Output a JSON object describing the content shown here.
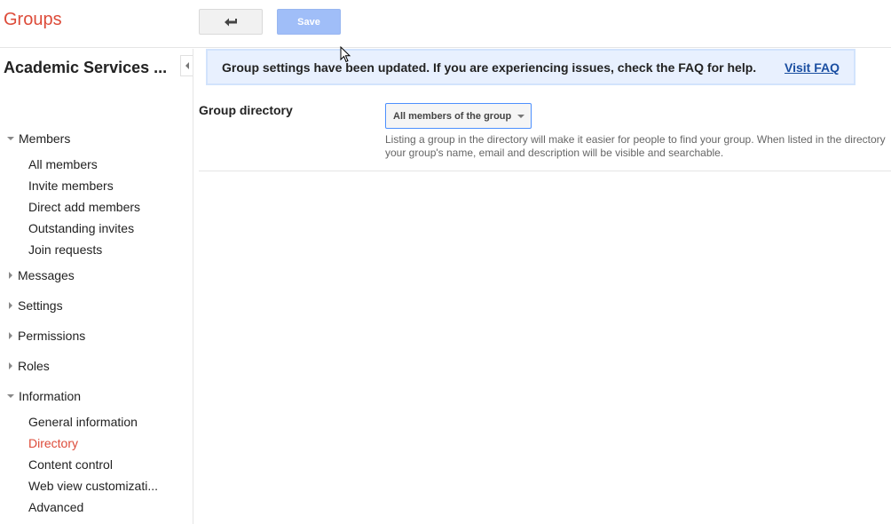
{
  "header": {
    "app_title": "Groups",
    "back_icon": "back-arrow-icon",
    "save_label": "Save"
  },
  "sidebar": {
    "group_name": "Academic Services ...",
    "collapse_icon": "collapse-left-icon",
    "sections": [
      {
        "label": "Members",
        "expanded": true,
        "items": [
          "All members",
          "Invite members",
          "Direct add members",
          "Outstanding invites",
          "Join requests"
        ]
      },
      {
        "label": "Messages",
        "expanded": false
      },
      {
        "label": "Settings",
        "expanded": false
      },
      {
        "label": "Permissions",
        "expanded": false
      },
      {
        "label": "Roles",
        "expanded": false
      },
      {
        "label": "Information",
        "expanded": true,
        "items": [
          "General information",
          "Directory",
          "Content control",
          "Web view customizati...",
          "Advanced"
        ]
      }
    ],
    "active_item": "Directory"
  },
  "banner": {
    "message": "Group settings have been updated. If you are experiencing issues, check the FAQ for help.",
    "link": "Visit FAQ"
  },
  "main": {
    "setting_label": "Group directory",
    "select_value": "All members of the group",
    "description": "Listing a group in the directory will make it easier for people to find your group. When listed in the directory your group's name, email and description will be visible and searchable."
  },
  "colors": {
    "brand": "#dd4b39",
    "save_disabled": "#a0bef8",
    "banner_bg": "#e8f0fe",
    "link": "#1a4ea1",
    "select_border": "#4d90fe"
  }
}
